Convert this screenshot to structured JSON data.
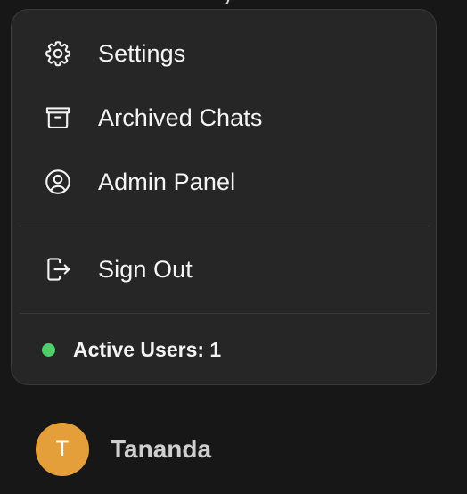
{
  "top_cutoff_text": "y",
  "menu": {
    "items": [
      {
        "label": "Settings",
        "icon": "gear-icon"
      },
      {
        "label": "Archived Chats",
        "icon": "archive-icon"
      },
      {
        "label": "Admin Panel",
        "icon": "user-circle-icon"
      }
    ],
    "sign_out": {
      "label": "Sign Out",
      "icon": "sign-out-icon"
    },
    "active_users": {
      "label": "Active Users: 1",
      "status_color": "#4fcf6a"
    }
  },
  "user": {
    "initial": "T",
    "name": "Tananda",
    "avatar_color": "#e59f3a"
  },
  "colors": {
    "background": "#171717",
    "menu_background": "#262626",
    "text": "#f5f5f5",
    "divider": "#3a3a3a"
  }
}
